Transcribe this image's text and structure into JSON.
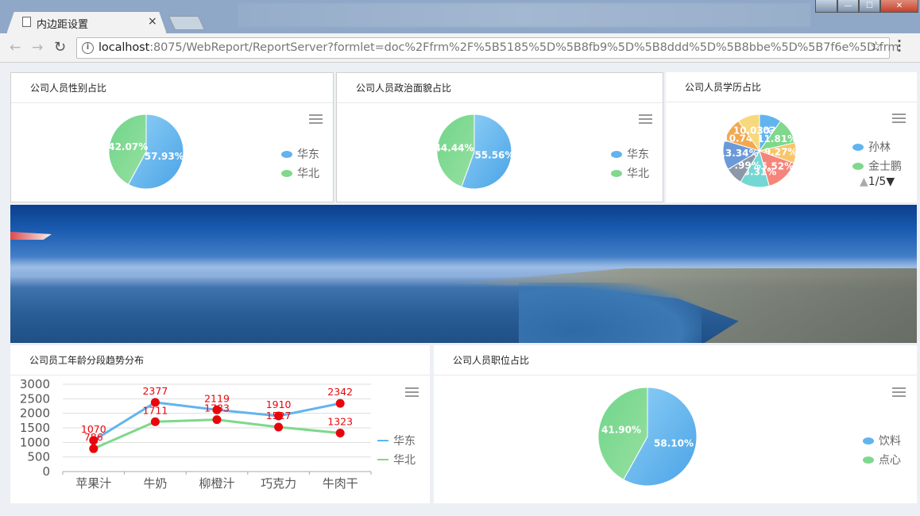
{
  "browser": {
    "tab_title": "内边距设置",
    "tab_close": "×",
    "url_host": "localhost",
    "url_rest": ":8075/WebReport/ReportServer?formlet=doc%2Ffrm%2F%5B5185%5D%5B8fb9%5D%5B8ddd%5D%5B8bbe%5D%5B7f6e%5D.frm",
    "back": "←",
    "forward": "→",
    "reload": "↻",
    "star": "☆",
    "info": "i",
    "win_min": "—",
    "win_max": "☐",
    "win_close": "✕"
  },
  "icons": {
    "back": "arrow-left-icon",
    "forward": "arrow-right-icon",
    "reload": "reload-icon",
    "info": "info-icon",
    "star": "star-icon",
    "menu": "kebab-menu-icon",
    "chart_menu": "hamburger-menu-icon"
  },
  "colors": {
    "blue": "#62b4ee",
    "green": "#7fd88c",
    "point": "#e8060c"
  },
  "panels": {
    "gender": {
      "title": "公司人员性别占比"
    },
    "politics": {
      "title": "公司人员政治面貌占比"
    },
    "education": {
      "title": "公司人员学历占比",
      "pager": "1/5",
      "pager_prev": "▲",
      "pager_next": "▼"
    },
    "trend": {
      "title": "公司员工年龄分段趋势分布"
    },
    "position": {
      "title": "公司人员职位占比"
    }
  },
  "chart_data": [
    {
      "type": "pie",
      "title": "公司人员性别占比",
      "labels": [
        "华东",
        "华北"
      ],
      "values": [
        57.93,
        42.07
      ],
      "value_labels": [
        "57.93%",
        "42.07%"
      ],
      "legend": "right"
    },
    {
      "type": "pie",
      "title": "公司人员政治面貌占比",
      "labels": [
        "华东",
        "华北"
      ],
      "values": [
        55.56,
        44.44
      ],
      "value_labels": [
        "55.56%",
        "44.44%"
      ],
      "legend": "right"
    },
    {
      "type": "pie",
      "title": "公司人员学历占比",
      "legend_visible": [
        "孙林",
        "金士鹏"
      ],
      "values": [
        10.03,
        11.81,
        9.27,
        15.52,
        13.31,
        7.99,
        13.34,
        10.74,
        10.03
      ],
      "value_labels": [
        "10.03%",
        "11.81%",
        "9.27%",
        "15.52%",
        "13.31%",
        "7.99%",
        "13.34%",
        "10.74%",
        "10.03%"
      ],
      "colors": [
        "#62b4ee",
        "#7fd88c",
        "#f7c56a",
        "#f5857a",
        "#74d7d3",
        "#8c97a7",
        "#6a9ad9",
        "#f3a74f",
        "#f6d97d"
      ],
      "legend": "right"
    },
    {
      "type": "line",
      "title": "公司员工年龄分段趋势分布",
      "categories": [
        "苹果汁",
        "牛奶",
        "柳橙汁",
        "巧克力",
        "牛肉干"
      ],
      "series": [
        {
          "name": "华东",
          "values": [
            1070,
            2377,
            2119,
            1910,
            2342
          ],
          "labels": [
            "1070",
            "2377",
            "2119",
            "1910",
            "2342"
          ]
        },
        {
          "name": "华北",
          "values": [
            786,
            1711,
            1783,
            1527,
            1323
          ],
          "labels": [
            "786",
            "1711",
            "1783",
            "1527",
            "1323"
          ]
        }
      ],
      "y_ticks": [
        "3000",
        "2500",
        "2000",
        "1500",
        "1000",
        "500",
        "0"
      ],
      "ylim": [
        0,
        3000
      ],
      "grid": true,
      "legend": "right"
    },
    {
      "type": "pie",
      "title": "公司人员职位占比",
      "labels": [
        "饮料",
        "点心"
      ],
      "values": [
        58.1,
        41.9
      ],
      "value_labels": [
        "58.10%",
        "41.90%"
      ],
      "legend": "right"
    }
  ]
}
